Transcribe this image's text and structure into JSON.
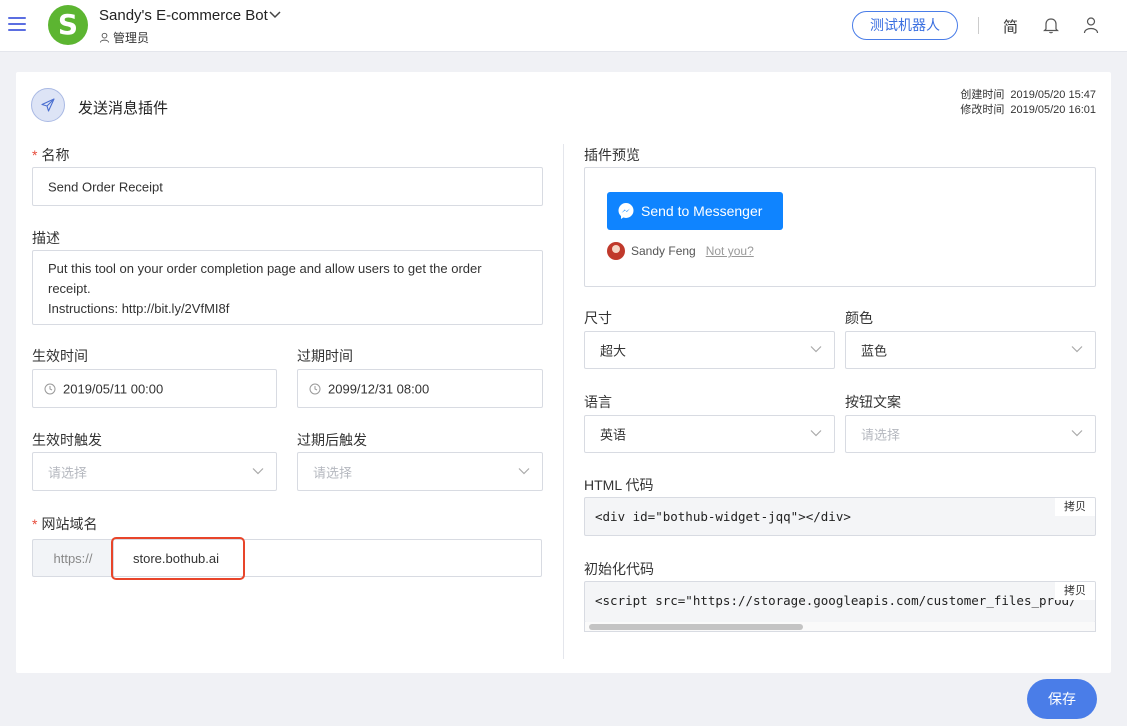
{
  "header": {
    "bot_name": "Sandy's E-commerce Bot",
    "role": "管理员",
    "test_bot_label": "测试机器人",
    "lang_toggle": "简",
    "logo_letter": "S"
  },
  "plugin": {
    "title": "发送消息插件",
    "created_label": "创建时间",
    "created_value": "2019/05/20 15:47",
    "modified_label": "修改时间",
    "modified_value": "2019/05/20 16:01"
  },
  "form": {
    "name_label": "名称",
    "name_value": "Send Order Receipt",
    "desc_label": "描述",
    "desc_line1": "Put this tool on your order completion page and allow users to get the order receipt.",
    "desc_line2": "Instructions: http://bit.ly/2VfMI8f",
    "start_label": "生效时间",
    "start_value": "2019/05/11 00:00",
    "end_label": "过期时间",
    "end_value": "2099/12/31 08:00",
    "start_trigger_label": "生效时触发",
    "start_trigger_placeholder": "请选择",
    "end_trigger_label": "过期后触发",
    "end_trigger_placeholder": "请选择",
    "domain_label": "网站域名",
    "domain_prefix": "https://",
    "domain_value": "store.bothub.ai"
  },
  "preview": {
    "label": "插件预览",
    "button_text": "Send to Messenger",
    "user_name": "Sandy Feng",
    "not_you": "Not you?"
  },
  "settings": {
    "size_label": "尺寸",
    "size_value": "超大",
    "color_label": "颜色",
    "color_value": "蓝色",
    "language_label": "语言",
    "language_value": "英语",
    "button_text_label": "按钮文案",
    "button_text_placeholder": "请选择"
  },
  "code": {
    "html_label": "HTML 代码",
    "html_value": "<div id=\"bothub-widget-jqq\"></div>",
    "init_label": "初始化代码",
    "init_value": "<script src=\"https://storage.googleapis.com/customer_files_prod/",
    "copy_label": "拷贝"
  },
  "actions": {
    "save_label": "保存"
  },
  "colors": {
    "accent": "#4a7de8",
    "messenger": "#0f84ff",
    "logo": "#5cb531",
    "highlight": "#e8452a"
  }
}
